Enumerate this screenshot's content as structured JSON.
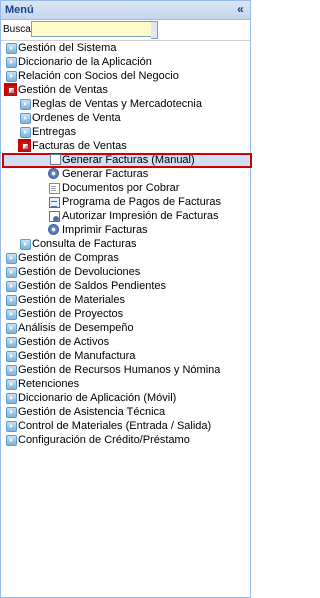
{
  "window": {
    "title": "Menú"
  },
  "search": {
    "label": "Buscar",
    "value": "",
    "placeholder": ""
  },
  "tree": [
    {
      "label": "Gestión del Sistema"
    },
    {
      "label": "Diccionario de la Aplicación"
    },
    {
      "label": "Relación con Socios del Negocio"
    },
    {
      "label": "Gestión de Ventas",
      "expanded": true
    },
    {
      "label": "Reglas de Ventas y Mercadotecnia"
    },
    {
      "label": "Ordenes de Venta"
    },
    {
      "label": "Entregas"
    },
    {
      "label": "Facturas de Ventas",
      "expanded": true
    },
    {
      "label": "Generar Facturas (Manual)",
      "selected": true
    },
    {
      "label": "Generar Facturas"
    },
    {
      "label": "Documentos por Cobrar"
    },
    {
      "label": "Programa de Pagos de Facturas"
    },
    {
      "label": "Autorizar Impresión de Facturas"
    },
    {
      "label": "Imprimir Facturas"
    },
    {
      "label": "Consulta de Facturas"
    },
    {
      "label": "Gestión de Compras"
    },
    {
      "label": "Gestión de Devoluciones"
    },
    {
      "label": "Gestión de Saldos Pendientes"
    },
    {
      "label": "Gestión de Materiales"
    },
    {
      "label": "Gestión de Proyectos"
    },
    {
      "label": "Análisis de Desempeño"
    },
    {
      "label": "Gestión de Activos"
    },
    {
      "label": "Gestión de Manufactura"
    },
    {
      "label": "Gestión de Recursos Humanos y Nómina"
    },
    {
      "label": "Retenciones"
    },
    {
      "label": "Diccionario de Aplicación (Móvil)"
    },
    {
      "label": "Gestión de Asistencia Técnica"
    },
    {
      "label": "Control de Materiales (Entrada / Salida)"
    },
    {
      "label": "Configuración de Crédito/Préstamo"
    }
  ]
}
